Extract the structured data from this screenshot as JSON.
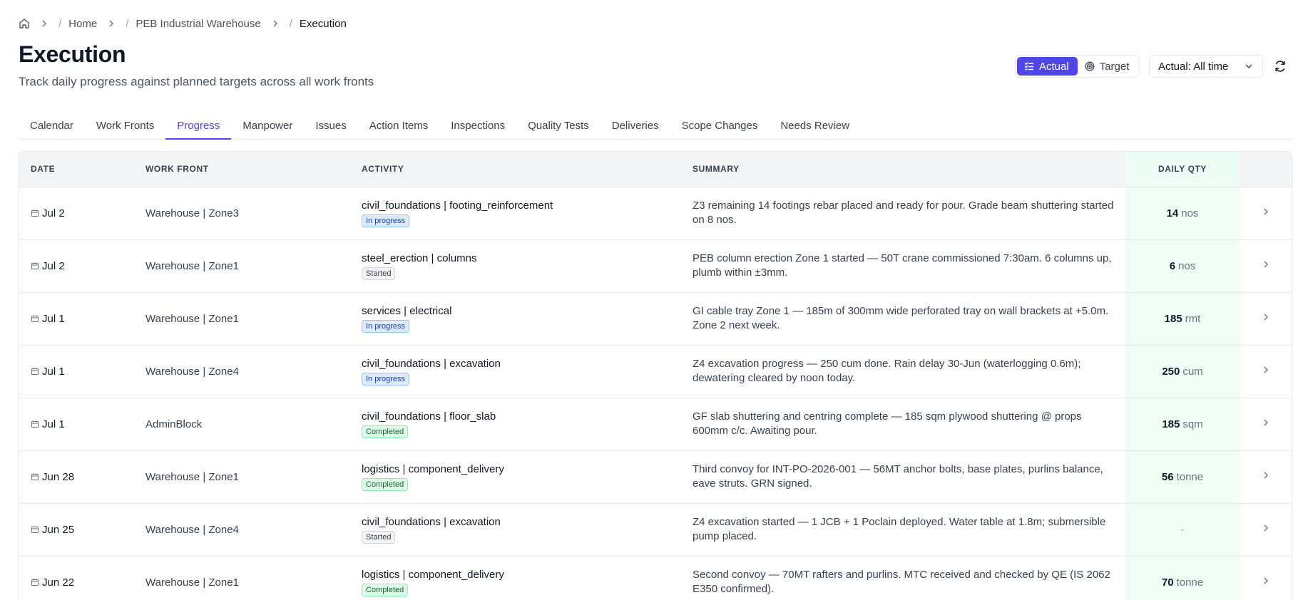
{
  "breadcrumb": {
    "items": [
      "Home",
      "PEB Industrial Warehouse",
      "Execution"
    ],
    "separator": "/"
  },
  "page": {
    "title": "Execution",
    "subtitle": "Track daily progress against planned targets across all work fronts"
  },
  "toggle": {
    "actual_label": "Actual",
    "target_label": "Target",
    "selected": "Actual"
  },
  "range_select": {
    "value": "Actual: All time"
  },
  "tabs": [
    {
      "label": "Calendar"
    },
    {
      "label": "Work Fronts"
    },
    {
      "label": "Progress",
      "active": true
    },
    {
      "label": "Manpower"
    },
    {
      "label": "Issues"
    },
    {
      "label": "Action Items"
    },
    {
      "label": "Inspections"
    },
    {
      "label": "Quality Tests"
    },
    {
      "label": "Deliveries"
    },
    {
      "label": "Scope Changes"
    },
    {
      "label": "Needs Review"
    }
  ],
  "table": {
    "headers": {
      "date": "DATE",
      "work_front": "WORK FRONT",
      "activity": "ACTIVITY",
      "summary": "SUMMARY",
      "daily_qty": "DAILY QTY"
    },
    "rows": [
      {
        "date": "Jul 2",
        "work_front": "Warehouse | Zone3",
        "activity": "civil_foundations | footing_reinforcement",
        "status": "In progress",
        "status_kind": "inprogress",
        "summary": "Z3 remaining 14 footings rebar placed and ready for pour. Grade beam shuttering started on 8 nos.",
        "qty": "14",
        "unit": "nos"
      },
      {
        "date": "Jul 2",
        "work_front": "Warehouse | Zone1",
        "activity": "steel_erection | columns",
        "status": "Started",
        "status_kind": "started",
        "summary": "PEB column erection Zone 1 started — 50T crane commissioned 7:30am. 6 columns up, plumb within ±3mm.",
        "qty": "6",
        "unit": "nos"
      },
      {
        "date": "Jul 1",
        "work_front": "Warehouse | Zone1",
        "activity": "services | electrical",
        "status": "In progress",
        "status_kind": "inprogress",
        "summary": "GI cable tray Zone 1 — 185m of 300mm wide perforated tray on wall brackets at +5.0m. Zone 2 next week.",
        "qty": "185",
        "unit": "rmt"
      },
      {
        "date": "Jul 1",
        "work_front": "Warehouse | Zone4",
        "activity": "civil_foundations | excavation",
        "status": "In progress",
        "status_kind": "inprogress",
        "summary": "Z4 excavation progress — 250 cum done. Rain delay 30-Jun (waterlogging 0.6m); dewatering cleared by noon today.",
        "qty": "250",
        "unit": "cum"
      },
      {
        "date": "Jul 1",
        "work_front": "AdminBlock",
        "activity": "civil_foundations | floor_slab",
        "status": "Completed",
        "status_kind": "completed",
        "summary": "GF slab shuttering and centring complete — 185 sqm plywood shuttering @ props 600mm c/c. Awaiting pour.",
        "qty": "185",
        "unit": "sqm"
      },
      {
        "date": "Jun 28",
        "work_front": "Warehouse | Zone1",
        "activity": "logistics | component_delivery",
        "status": "Completed",
        "status_kind": "completed",
        "summary": "Third convoy for INT-PO-2026-001 — 56MT anchor bolts, base plates, purlins balance, eave struts. GRN signed.",
        "qty": "56",
        "unit": "tonne"
      },
      {
        "date": "Jun 25",
        "work_front": "Warehouse | Zone4",
        "activity": "civil_foundations | excavation",
        "status": "Started",
        "status_kind": "started",
        "summary": "Z4 excavation started — 1 JCB + 1 Poclain deployed. Water table at 1.8m; submersible pump placed.",
        "qty": "-",
        "unit": ""
      },
      {
        "date": "Jun 22",
        "work_front": "Warehouse | Zone1",
        "activity": "logistics | component_delivery",
        "status": "Completed",
        "status_kind": "completed",
        "summary": "Second convoy — 70MT rafters and purlins. MTC received and checked by QE (IS 2062 E350 confirmed).",
        "qty": "70",
        "unit": "tonne"
      }
    ]
  },
  "icons": {
    "home": "home-icon",
    "chevron": "chevron-right-icon",
    "calendar": "calendar-icon",
    "checklist": "checklist-icon",
    "target": "target-icon",
    "refresh": "refresh-icon"
  },
  "colors": {
    "accent": "#4f46e5",
    "qty_column_bg": "#f0fdf4",
    "in_progress": "#dbeafe",
    "completed": "#dcfce7"
  }
}
